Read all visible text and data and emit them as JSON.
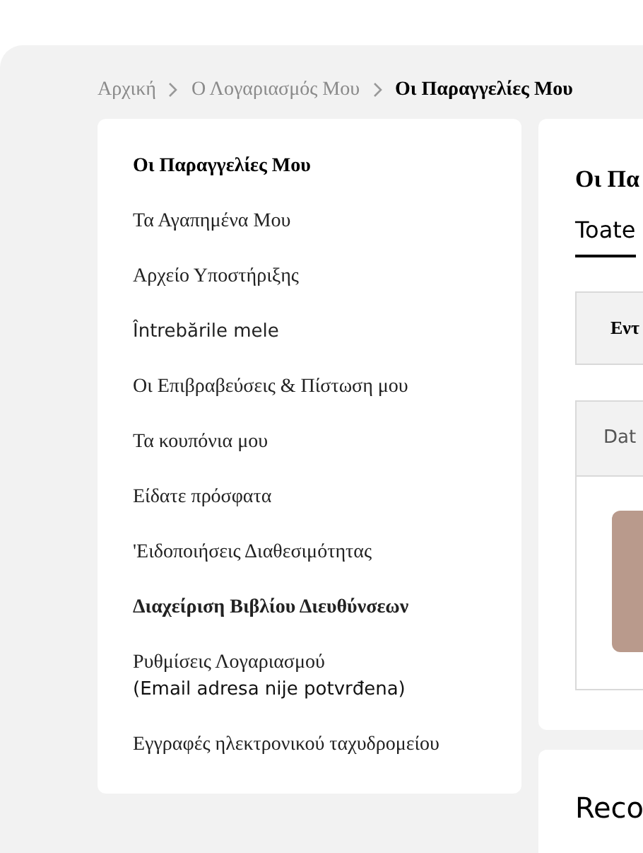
{
  "breadcrumb": [
    {
      "label": "Αρχική",
      "current": false
    },
    {
      "label": "Ο Λογαριασμός Μου",
      "current": false
    },
    {
      "label": "Οι Παραγγελίες Μου",
      "current": true
    }
  ],
  "sidebar": {
    "items": [
      {
        "label": "Οι Παραγγελίες Μου",
        "selected": true,
        "kind": "greek"
      },
      {
        "label": "Τα Αγαπημένα Μου",
        "selected": false,
        "kind": "greek"
      },
      {
        "label": "Αρχείο Υποστήριξης",
        "selected": false,
        "kind": "greek"
      },
      {
        "label": "Întrebările mele",
        "selected": false,
        "kind": "latin"
      },
      {
        "label": "Οι Επιβραβεύσεις & Πίστωση μου",
        "selected": false,
        "kind": "greek"
      },
      {
        "label": "Τα κουπόνια μου",
        "selected": false,
        "kind": "greek"
      },
      {
        "label": "Είδατε πρόσφατα",
        "selected": false,
        "kind": "greek"
      },
      {
        "label": "'Ειδοποιήσεις Διαθεσιμότητας",
        "selected": false,
        "kind": "greek"
      },
      {
        "label": "Διαχείριση Βιβλίου Διευθύνσεων",
        "selected": false,
        "bold": true,
        "kind": "greek"
      },
      {
        "label": "Ρυθμίσεις Λογαριασμού",
        "note": "(Email adresa nije potvrđena)",
        "selected": false,
        "kind": "greek"
      },
      {
        "label": "Εγγραφές ηλεκτρονικού ταχυδρομείου",
        "selected": false,
        "kind": "greek"
      }
    ]
  },
  "orders": {
    "title": "Οι Πα",
    "tabs": [
      {
        "label": "Toate",
        "selected": true
      }
    ],
    "filter": "Εντ",
    "table": {
      "columns": [
        "Dat"
      ]
    }
  },
  "recommendations": {
    "title": "Reco"
  }
}
